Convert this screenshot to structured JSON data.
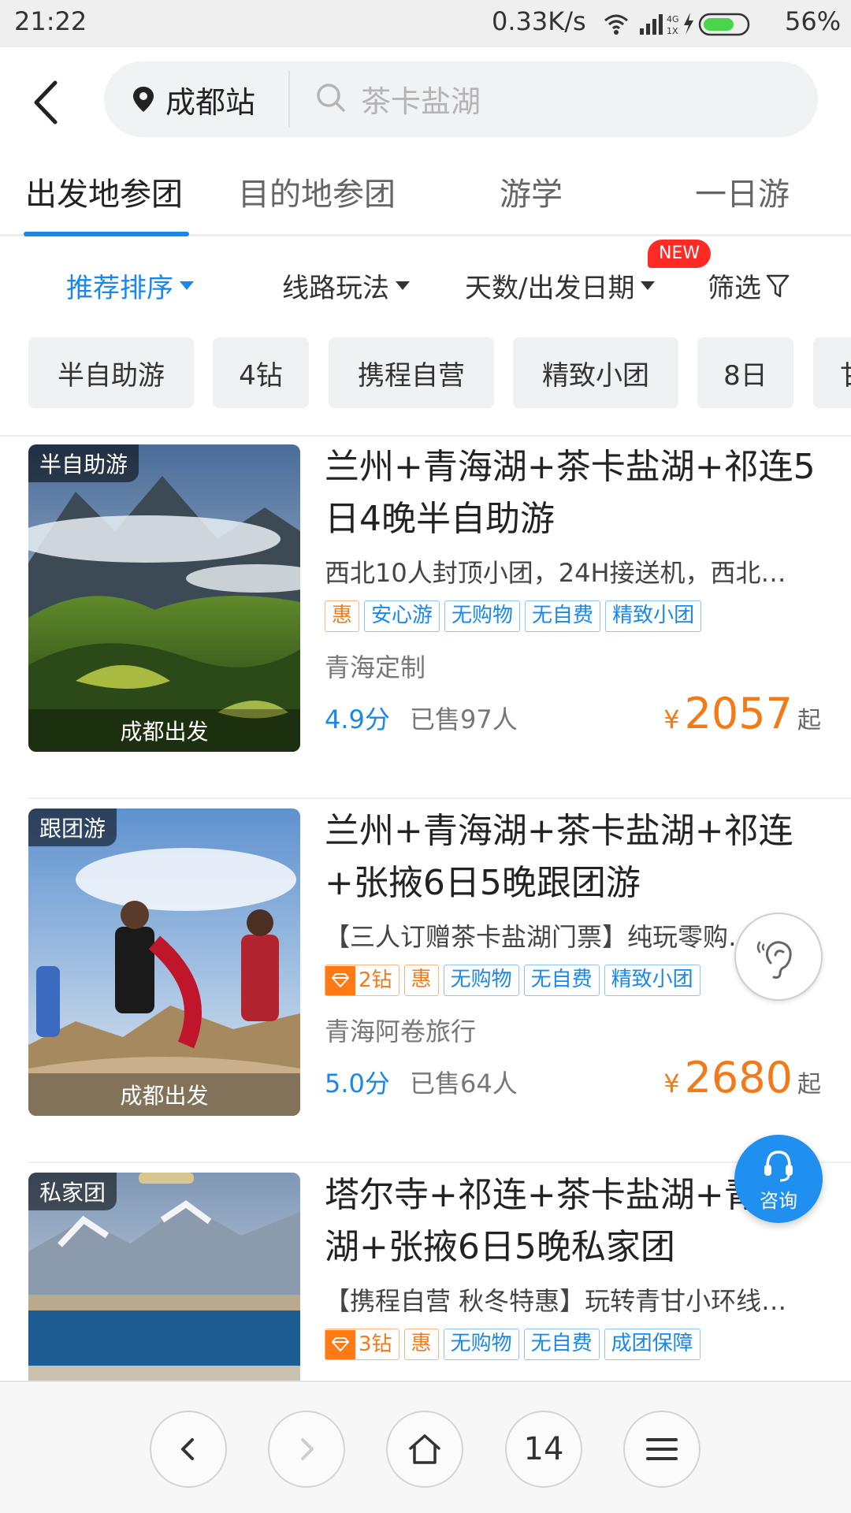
{
  "status_bar": {
    "time": "21:22",
    "net_speed": "0.33K/s",
    "battery": "56%"
  },
  "header": {
    "city": "成都站",
    "search_placeholder": "茶卡盐湖"
  },
  "tabs": [
    {
      "label": "出发地参团",
      "active": true
    },
    {
      "label": "目的地参团",
      "active": false
    },
    {
      "label": "游学",
      "active": false
    },
    {
      "label": "一日游",
      "active": false
    }
  ],
  "sort_bar": {
    "recommend": "推荐排序",
    "route": "线路玩法",
    "days_date": "天数/出发日期",
    "new_badge": "NEW",
    "filter": "筛选"
  },
  "chips": [
    "半自助游",
    "4钻",
    "携程自营",
    "精致小团",
    "8日",
    "甘"
  ],
  "products": [
    {
      "type_tag": "半自助游",
      "departure": "成都出发",
      "title": "兰州+青海湖+茶卡盐湖+祁连5日4晚半自助游",
      "desc": "西北10人封顶小团，24H接送机，西北…",
      "diamond": "",
      "tags": [
        "惠",
        "安心游",
        "无购物",
        "无自费",
        "精致小团"
      ],
      "vendor": "青海定制",
      "score": "4.9分",
      "sold": "已售97人",
      "currency": "¥",
      "price": "2057",
      "price_suffix": "起"
    },
    {
      "type_tag": "跟团游",
      "departure": "成都出发",
      "title": "兰州+青海湖+茶卡盐湖+祁连+张掖6日5晚跟团游",
      "desc": "【三人订赠茶卡盐湖门票】纯玩零购…",
      "diamond": "2钻",
      "tags": [
        "惠",
        "无购物",
        "无自费",
        "精致小团"
      ],
      "vendor": "青海阿卷旅行",
      "score": "5.0分",
      "sold": "已售64人",
      "currency": "¥",
      "price": "2680",
      "price_suffix": "起"
    },
    {
      "type_tag": "私家团",
      "departure": "",
      "title": "塔尔寺+祁连+茶卡盐湖+青海湖+张掖6日5晚私家团",
      "desc": "【携程自营 秋冬特惠】玩转青甘小环线…",
      "diamond": "3钻",
      "tags": [
        "惠",
        "无购物",
        "无自费",
        "成团保障"
      ],
      "vendor": "",
      "score": "",
      "sold": "",
      "currency": "",
      "price": "",
      "price_suffix": ""
    }
  ],
  "float": {
    "consult_label": "咨询"
  },
  "bottom_nav": {
    "tab_count": "14"
  },
  "colors": {
    "accent_blue": "#1a88ea",
    "price_orange": "#f37a19",
    "new_badge_red": "#ff2a25"
  }
}
